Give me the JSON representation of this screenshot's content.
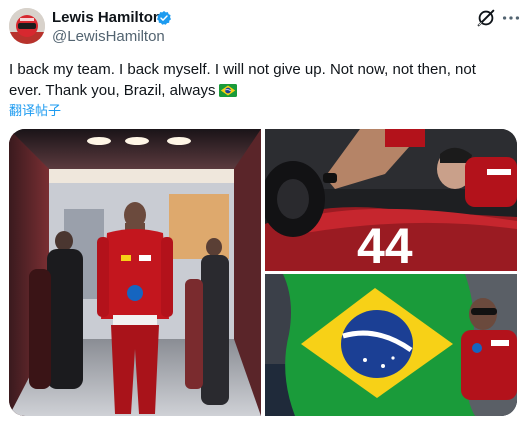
{
  "author": {
    "display_name": "Lewis Hamilton",
    "handle": "@LewisHamilton",
    "avatar_icon": "avatar-photo",
    "verified_icon": "verified-badge-icon"
  },
  "header_actions": {
    "grok_icon": "grok-icon",
    "more_icon": "more-options-icon"
  },
  "tweet": {
    "text": "I back my team. I back myself. I will not give up. Not now, not then, not ever. Thank you, Brazil, always",
    "emoji": "brazil-flag-emoji",
    "translate_label": "翻译帖子"
  },
  "media": {
    "photos": [
      {
        "id": "photo-hallway",
        "description_icon": "photo"
      },
      {
        "id": "photo-car-44",
        "overlay_text": "44"
      },
      {
        "id": "photo-brazil-flag"
      }
    ]
  },
  "colors": {
    "text": "#0f1419",
    "secondary": "#536471",
    "accent": "#1d9bf0",
    "ferrari_red": "#b3121b"
  }
}
